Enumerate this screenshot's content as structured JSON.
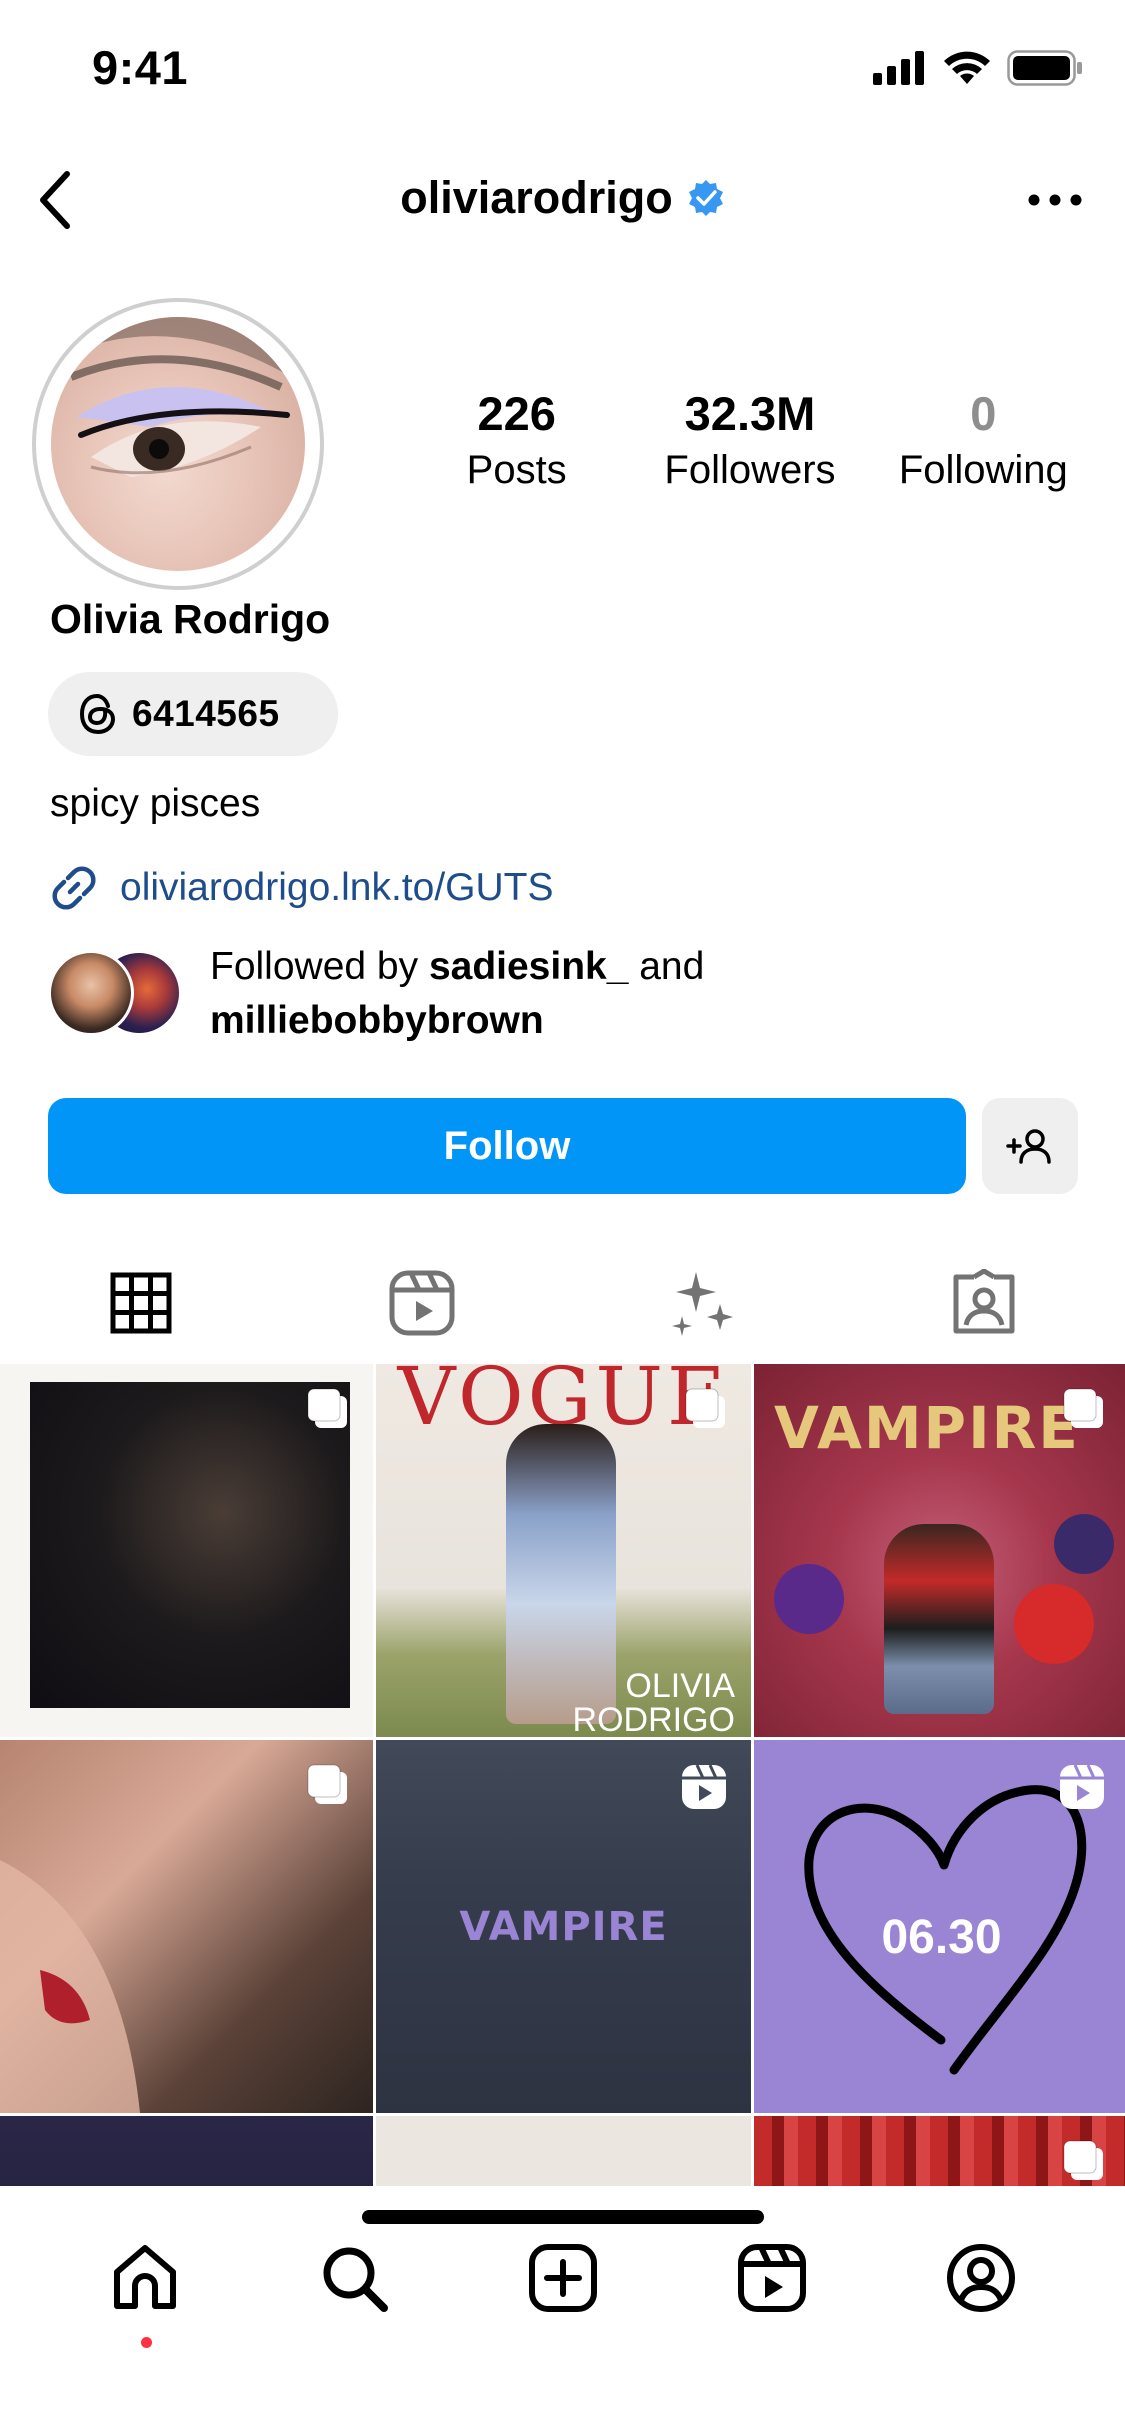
{
  "status_bar": {
    "time": "9:41"
  },
  "header": {
    "username": "oliviarodrigo"
  },
  "profile": {
    "name": "Olivia Rodrigo",
    "threads_label": "6414565",
    "bio": "spicy pisces",
    "link": "oliviarodrigo.lnk.to/GUTS",
    "followed_by_prefix": "Followed by ",
    "followed_by_user1": "sadiesink_",
    "followed_by_and": " and",
    "followed_by_user2": "milliebobbybrown"
  },
  "stats": [
    {
      "value": "226",
      "label": "Posts"
    },
    {
      "value": "32.3M",
      "label": "Followers"
    },
    {
      "value": "0",
      "label": "Following"
    }
  ],
  "actions": {
    "follow_label": "Follow"
  },
  "tabs": [
    {
      "icon": "grid-icon",
      "active": true
    },
    {
      "icon": "reels-icon",
      "active": false
    },
    {
      "icon": "sparkles-icon",
      "active": false
    },
    {
      "icon": "tagged-icon",
      "active": false
    }
  ],
  "posts": [
    {
      "kind": "carousel"
    },
    {
      "kind": "carousel",
      "text1": "VOGUE",
      "text2": "OLIVIA",
      "text3": "RODRIGO"
    },
    {
      "kind": "carousel",
      "text1": "VAMPIRE"
    },
    {
      "kind": "carousel"
    },
    {
      "kind": "reel",
      "text1": "VAMPIRE"
    },
    {
      "kind": "reel",
      "text1": "06.30"
    },
    {
      "kind": "photo"
    },
    {
      "kind": "photo"
    },
    {
      "kind": "carousel"
    }
  ],
  "bottom_nav": [
    "home-icon",
    "search-icon",
    "create-icon",
    "reels-icon",
    "profile-icon"
  ],
  "colors": {
    "follow_blue": "#0095f6",
    "verified_blue": "#3897f0",
    "link_blue": "#1f4d8c",
    "notification_red": "#ff3040"
  }
}
